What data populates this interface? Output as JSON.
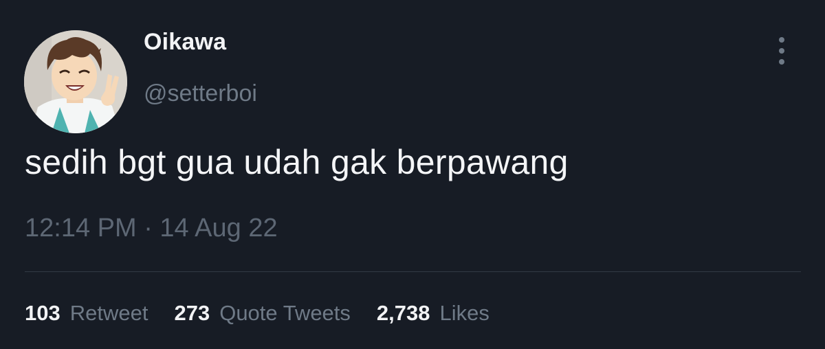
{
  "author": {
    "display_name": "Oikawa",
    "handle": "@setterboi",
    "avatar_icon": "anime-character-avatar"
  },
  "tweet": {
    "text": "sedih bgt gua udah gak berpawang",
    "timestamp": "12:14 PM · 14 Aug 22"
  },
  "stats": [
    {
      "count": "103",
      "label": "Retweet"
    },
    {
      "count": "273",
      "label": "Quote Tweets"
    },
    {
      "count": "2,738",
      "label": "Likes"
    }
  ],
  "menu": {
    "icon": "more-vertical-icon"
  },
  "colors": {
    "background": "#171c25",
    "primary_text": "#f2f3f5",
    "secondary_text": "#6f7a87",
    "divider": "#333a45"
  }
}
